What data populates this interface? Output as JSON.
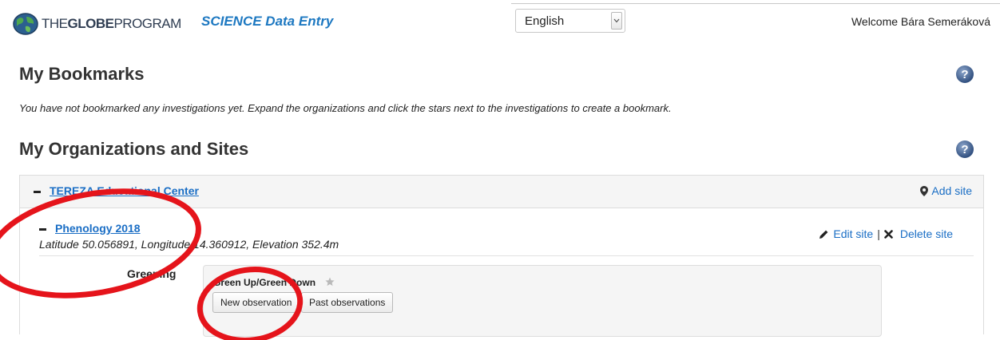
{
  "header": {
    "logo": {
      "the": "THE",
      "globe": "GLOBE",
      "program": "PROGRAM"
    },
    "app_title": "SCIENCE Data Entry",
    "language": {
      "selected": "English"
    },
    "welcome": "Welcome Bára Semeráková"
  },
  "bookmarks": {
    "title": "My Bookmarks",
    "note": "You have not bookmarked any investigations yet. Expand the organizations and click the stars next to the investigations to create a bookmark."
  },
  "organizations": {
    "title": "My Organizations and Sites",
    "org": {
      "name": "TEREZA Educational Center",
      "add_site": "Add site",
      "site": {
        "name": "Phenology 2018",
        "info": "Latitude 50.056891, Longitude 14.360912, Elevation 352.4m",
        "edit_label": "Edit site",
        "separator": "|",
        "delete_label": "Delete site",
        "protocol": {
          "label": "Greening",
          "investigation": "Green Up/Green Down",
          "new_observation": "New observation",
          "past_observations": "Past observations"
        }
      }
    }
  },
  "colors": {
    "link": "#1a6ec5",
    "app_title": "#1d78c1",
    "annotation": "#e5141b",
    "help_icon": "#44628f"
  },
  "icons": [
    "globe-logo-icon",
    "chevron-down-icon",
    "help-icon",
    "minus-icon",
    "map-marker-icon",
    "pencil-icon",
    "times-icon",
    "star-icon"
  ]
}
